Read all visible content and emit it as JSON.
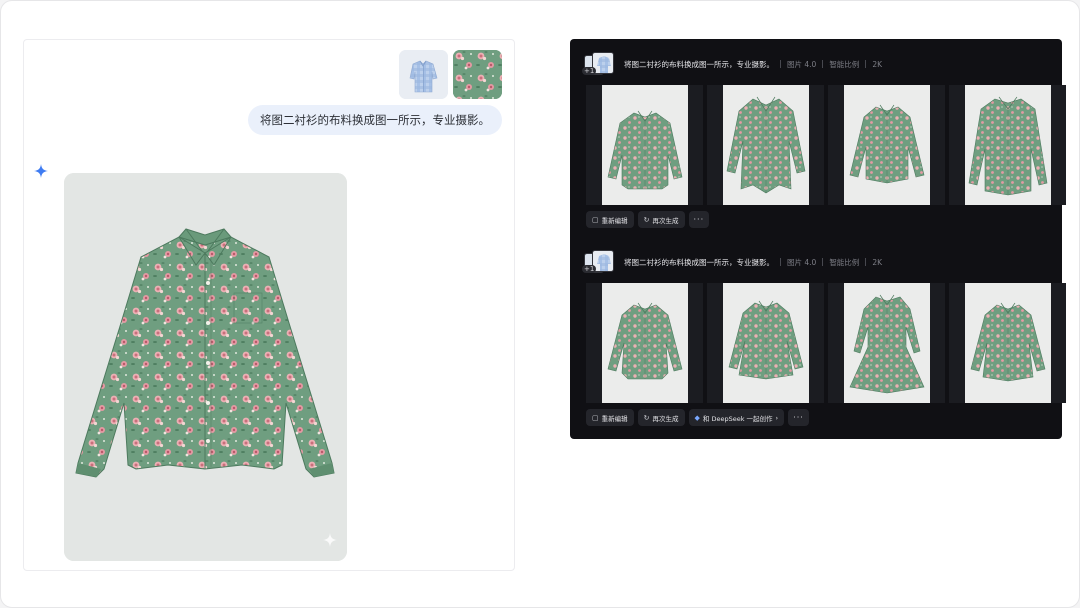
{
  "chat": {
    "prompt": "将图二衬衫的布料换成图一所示，专业摄影。",
    "reference_images": [
      "blue-shirt-reference",
      "floral-fabric-reference"
    ],
    "assistant_icon": "sparkle-icon",
    "result_image": "floral-shirt-result"
  },
  "gen_panel": {
    "runs": [
      {
        "prompt": "将图二衬衫的布料换成图一所示，专业摄影。",
        "model": "图片 4.0",
        "ratio": "智能比例",
        "resolution": "2K",
        "ref_count": "+1",
        "actions": [
          {
            "icon": "edit-icon",
            "label": "重新编辑"
          },
          {
            "icon": "refresh-icon",
            "label": "再次生成"
          },
          {
            "icon": "more-icon",
            "label": "···"
          }
        ]
      },
      {
        "prompt": "将图二衬衫的布料换成图一所示，专业摄影。",
        "model": "图片 4.0",
        "ratio": "智能比例",
        "resolution": "2K",
        "ref_count": "+1",
        "actions": [
          {
            "icon": "edit-icon",
            "label": "重新编辑"
          },
          {
            "icon": "refresh-icon",
            "label": "再次生成"
          },
          {
            "icon": "deepseek-icon",
            "label": "和 DeepSeek 一起创作",
            "chevron": "›"
          },
          {
            "icon": "more-icon",
            "label": "···"
          }
        ]
      }
    ]
  },
  "colors": {
    "fabric_green": "#6f9e80",
    "flower_pink": "#e7a2a8",
    "panel_dark": "#101014",
    "bubble": "#eaf0fb",
    "spark_blue": "#3f7cf2"
  }
}
